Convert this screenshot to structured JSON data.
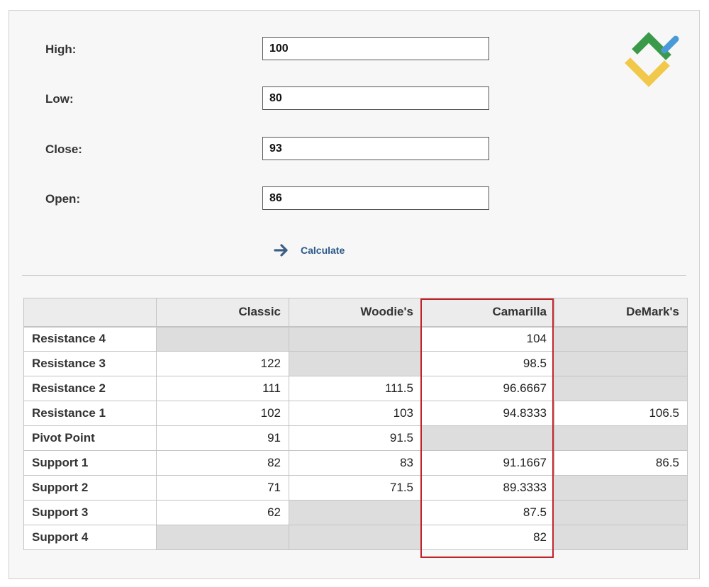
{
  "form": {
    "fields": [
      {
        "label": "High:",
        "value": "100"
      },
      {
        "label": "Low:",
        "value": "80"
      },
      {
        "label": "Close:",
        "value": "93"
      },
      {
        "label": "Open:",
        "value": "86"
      }
    ],
    "calculate_label": "Calculate"
  },
  "logo": {
    "icon": "brand-logo-icon",
    "colors": [
      "#3a9a4a",
      "#4a9ad8",
      "#f2c84b"
    ]
  },
  "table": {
    "headers": [
      "",
      "Classic",
      "Woodie's",
      "Camarilla",
      "DeMark's"
    ],
    "highlighted_column": "Camarilla",
    "highlight_color": "#c0232b",
    "rows": [
      {
        "label": "Resistance 4",
        "cells": [
          "",
          "",
          "104",
          ""
        ]
      },
      {
        "label": "Resistance 3",
        "cells": [
          "122",
          "",
          "98.5",
          ""
        ]
      },
      {
        "label": "Resistance 2",
        "cells": [
          "111",
          "111.5",
          "96.6667",
          ""
        ]
      },
      {
        "label": "Resistance 1",
        "cells": [
          "102",
          "103",
          "94.8333",
          "106.5"
        ]
      },
      {
        "label": "Pivot Point",
        "cells": [
          "91",
          "91.5",
          "",
          ""
        ]
      },
      {
        "label": "Support 1",
        "cells": [
          "82",
          "83",
          "91.1667",
          "86.5"
        ]
      },
      {
        "label": "Support 2",
        "cells": [
          "71",
          "71.5",
          "89.3333",
          ""
        ]
      },
      {
        "label": "Support 3",
        "cells": [
          "62",
          "",
          "87.5",
          ""
        ]
      },
      {
        "label": "Support 4",
        "cells": [
          "",
          "",
          "82",
          ""
        ]
      }
    ]
  }
}
